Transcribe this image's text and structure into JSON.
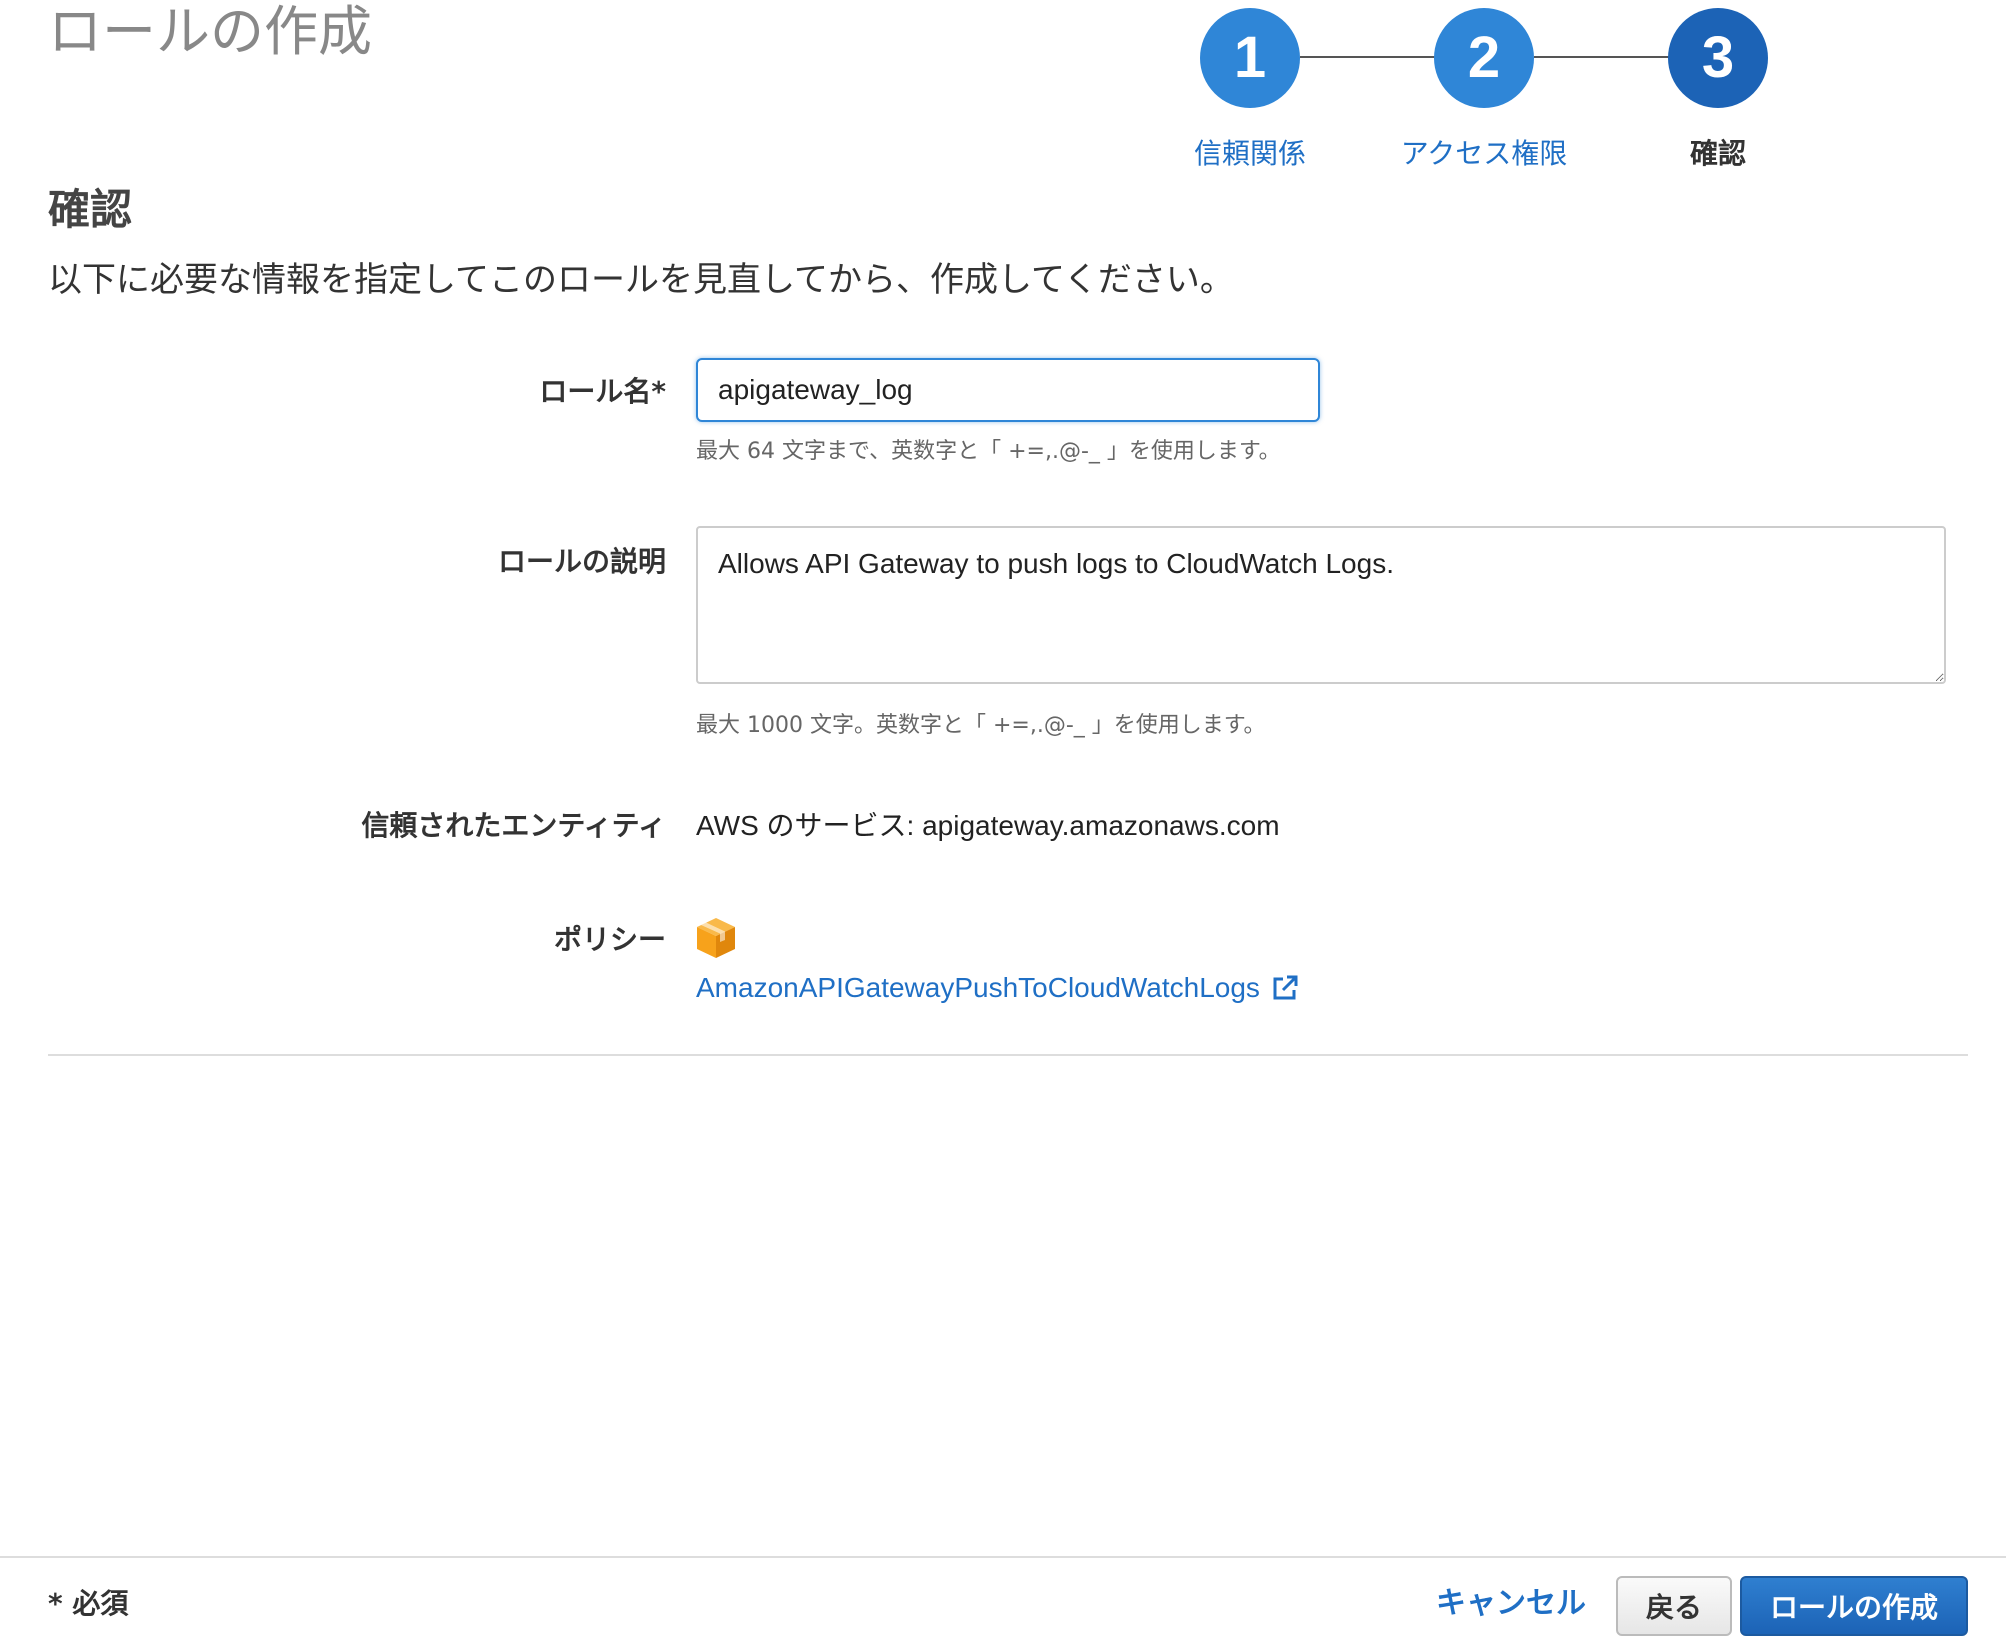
{
  "page": {
    "title": "ロールの作成"
  },
  "stepper": {
    "steps": [
      {
        "number": "1",
        "label": "信頼関係",
        "state": "done"
      },
      {
        "number": "2",
        "label": "アクセス権限",
        "state": "done"
      },
      {
        "number": "3",
        "label": "確認",
        "state": "current"
      }
    ]
  },
  "section": {
    "title": "確認",
    "description": "以下に必要な情報を指定してこのロールを見直してから、作成してください。"
  },
  "form": {
    "role_name": {
      "label": "ロール名*",
      "value": "apigateway_log",
      "hint": "最大 64 文字まで、英数字と「 +=,.@-_ 」を使用します。"
    },
    "role_description": {
      "label": "ロールの説明",
      "value": "Allows API Gateway to push logs to CloudWatch Logs.",
      "hint": "最大 1000 文字。英数字と「 +=,.@-_ 」を使用します。"
    },
    "trusted_entity": {
      "label": "信頼されたエンティティ",
      "value": "AWS のサービス: apigateway.amazonaws.com"
    },
    "policy": {
      "label": "ポリシー",
      "icon": "aws-managed-policy-cube-icon",
      "name": "AmazonAPIGatewayPushToCloudWatchLogs",
      "link_icon": "external-link-icon"
    }
  },
  "footer": {
    "required_note": "* 必須",
    "cancel_label": "キャンセル",
    "back_label": "戻る",
    "create_label": "ロールの作成"
  },
  "colors": {
    "accent": "#2f86d7",
    "accent_dark": "#1c63b6",
    "link": "#1f6fc5",
    "policy_icon": "#f7a21b"
  }
}
